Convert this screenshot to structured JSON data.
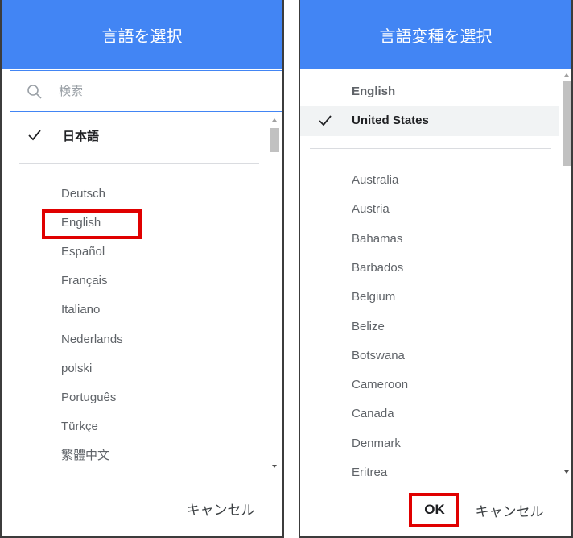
{
  "language_dialog": {
    "title": "言語を選択",
    "search_placeholder": "検索",
    "selected": "日本語",
    "items": [
      "Deutsch",
      "English",
      "Español",
      "Français",
      "Italiano",
      "Nederlands",
      "polski",
      "Português",
      "Türkçe",
      "繁體中文"
    ],
    "cancel_label": "キャンセル"
  },
  "variant_dialog": {
    "title": "言語変種を選択",
    "group_label": "English",
    "selected": "United States",
    "items": [
      "Australia",
      "Austria",
      "Bahamas",
      "Barbados",
      "Belgium",
      "Belize",
      "Botswana",
      "Cameroon",
      "Canada",
      "Denmark",
      "Eritrea"
    ],
    "ok_label": "OK",
    "cancel_label": "キャンセル"
  },
  "colors": {
    "header": "#4285f4",
    "highlight": "#e00000"
  }
}
